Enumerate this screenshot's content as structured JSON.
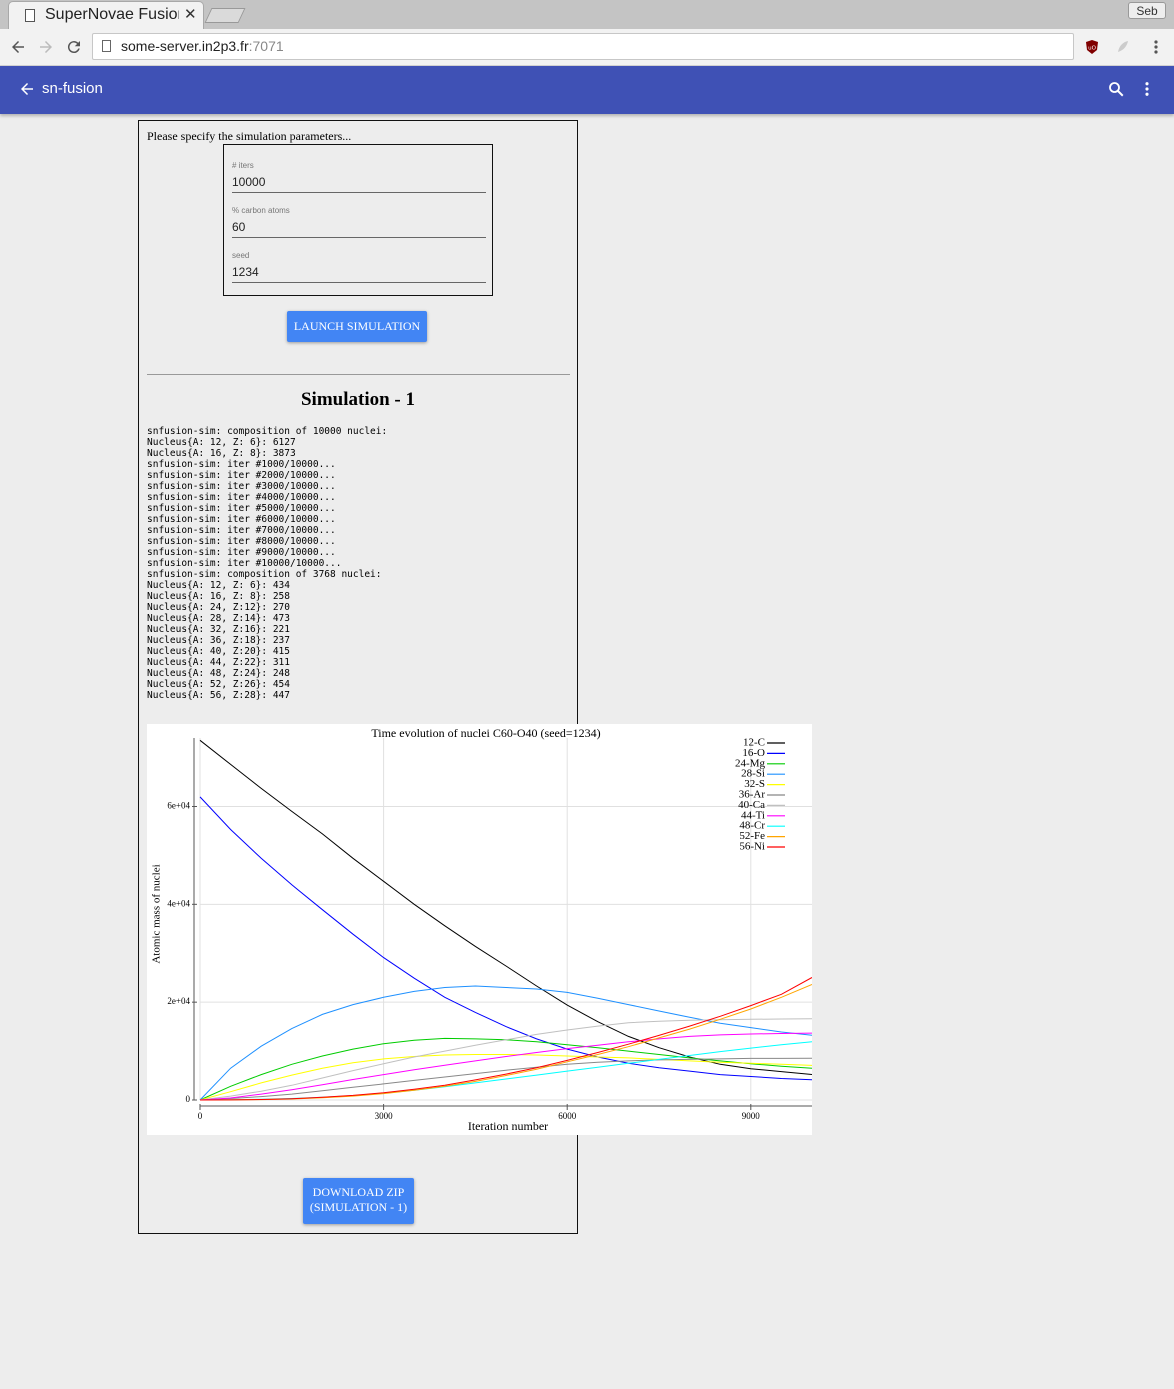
{
  "browser": {
    "tab_title": "SuperNovae Fusion",
    "close_glyph": "✕",
    "profile_name": "Seb",
    "url_host": "some-server.in2p3.fr",
    "url_port": ":7071",
    "icons": [
      "back-icon",
      "forward-icon",
      "reload-icon",
      "page-icon",
      "ublock-icon",
      "extension-icon",
      "menu-icon"
    ]
  },
  "appbar": {
    "title": "sn-fusion",
    "color": "#3f51b5",
    "icons": [
      "arrow-back-icon",
      "search-icon",
      "more-vert-icon"
    ]
  },
  "form": {
    "intro": "Please specify the simulation parameters...",
    "fields": [
      {
        "label": "# iters",
        "value": "10000"
      },
      {
        "label": "% carbon atoms",
        "value": "60"
      },
      {
        "label": "seed",
        "value": "1234"
      }
    ],
    "launch_label": "LAUNCH SIMULATION"
  },
  "simulation": {
    "title": "Simulation - 1",
    "log": "snfusion-sim: composition of 10000 nuclei:\nNucleus{A: 12, Z: 6}: 6127\nNucleus{A: 16, Z: 8}: 3873\nsnfusion-sim: iter #1000/10000...\nsnfusion-sim: iter #2000/10000...\nsnfusion-sim: iter #3000/10000...\nsnfusion-sim: iter #4000/10000...\nsnfusion-sim: iter #5000/10000...\nsnfusion-sim: iter #6000/10000...\nsnfusion-sim: iter #7000/10000...\nsnfusion-sim: iter #8000/10000...\nsnfusion-sim: iter #9000/10000...\nsnfusion-sim: iter #10000/10000...\nsnfusion-sim: composition of 3768 nuclei:\nNucleus{A: 12, Z: 6}: 434\nNucleus{A: 16, Z: 8}: 258\nNucleus{A: 24, Z:12}: 270\nNucleus{A: 28, Z:14}: 473\nNucleus{A: 32, Z:16}: 221\nNucleus{A: 36, Z:18}: 237\nNucleus{A: 40, Z:20}: 415\nNucleus{A: 44, Z:22}: 311\nNucleus{A: 48, Z:24}: 248\nNucleus{A: 52, Z:26}: 454\nNucleus{A: 56, Z:28}: 447",
    "download_label_line1": "DOWNLOAD ZIP",
    "download_label_line2": "(SIMULATION - 1)",
    "button_color": "#4285f4"
  },
  "chart_data": {
    "type": "line",
    "title": "Time evolution of nuclei C60-O40 (seed=1234)",
    "xlabel": "Iteration number",
    "ylabel": "Atomic mass of nuclei",
    "xlim": [
      0,
      10000
    ],
    "ylim": [
      0,
      74000
    ],
    "x_ticks": [
      0,
      3000,
      6000,
      9000
    ],
    "x_tick_labels": [
      "0",
      "3000",
      "6000",
      "9000"
    ],
    "y_ticks": [
      0,
      20000,
      40000,
      60000
    ],
    "y_tick_labels": [
      "0",
      "2e+04",
      "4e+04",
      "6e+04"
    ],
    "grid": true,
    "legend_position": "top-right",
    "x": [
      0,
      500,
      1000,
      1500,
      2000,
      2500,
      3000,
      3500,
      4000,
      4500,
      5000,
      5500,
      6000,
      6500,
      7000,
      7500,
      8000,
      8500,
      9000,
      9500,
      10000
    ],
    "series": [
      {
        "name": "12-C",
        "color": "#000000",
        "values": [
          73524,
          68600,
          63700,
          59000,
          54400,
          49400,
          44700,
          40000,
          35600,
          31400,
          27400,
          23300,
          19400,
          16000,
          13000,
          10700,
          8800,
          7300,
          6400,
          5800,
          5208
        ]
      },
      {
        "name": "16-O",
        "color": "#0000ff",
        "values": [
          61968,
          55300,
          49400,
          44000,
          38900,
          33900,
          29100,
          24900,
          21000,
          17900,
          15000,
          12500,
          10400,
          8800,
          7500,
          6600,
          5900,
          5200,
          4800,
          4400,
          4128
        ]
      },
      {
        "name": "24-Mg",
        "color": "#00cc00",
        "values": [
          0,
          2800,
          5200,
          7300,
          9000,
          10400,
          11500,
          12200,
          12600,
          12500,
          12300,
          11900,
          11300,
          10700,
          10000,
          9300,
          8600,
          8000,
          7400,
          6900,
          6480
        ]
      },
      {
        "name": "28-Si",
        "color": "#1e90ff",
        "values": [
          0,
          6500,
          11000,
          14600,
          17500,
          19500,
          21000,
          22200,
          23000,
          23300,
          23000,
          22700,
          22000,
          20800,
          19500,
          18200,
          16900,
          15700,
          14800,
          13900,
          13244
        ]
      },
      {
        "name": "32-S",
        "color": "#ffff00",
        "values": [
          0,
          1700,
          3500,
          5100,
          6500,
          7600,
          8400,
          8900,
          9200,
          9300,
          9300,
          9200,
          9000,
          8800,
          8600,
          8300,
          8000,
          7700,
          7500,
          7300,
          7072
        ]
      },
      {
        "name": "36-Ar",
        "color": "#888888",
        "values": [
          0,
          300,
          700,
          1200,
          1900,
          2600,
          3300,
          4000,
          4700,
          5400,
          6100,
          6700,
          7300,
          7700,
          8000,
          8200,
          8300,
          8400,
          8500,
          8500,
          8532
        ]
      },
      {
        "name": "40-Ca",
        "color": "#c0c0c0",
        "values": [
          0,
          800,
          1800,
          3000,
          4500,
          6000,
          7400,
          8800,
          10000,
          11200,
          12300,
          13400,
          14300,
          15100,
          15800,
          16100,
          16300,
          16400,
          16500,
          16550,
          16600
        ]
      },
      {
        "name": "44-Ti",
        "color": "#ff00ff",
        "values": [
          0,
          400,
          1200,
          2100,
          3100,
          4200,
          5200,
          6200,
          7100,
          8000,
          8900,
          9700,
          10500,
          11200,
          11900,
          12500,
          13000,
          13300,
          13500,
          13600,
          13684
        ]
      },
      {
        "name": "48-Cr",
        "color": "#00ffff",
        "values": [
          0,
          50,
          150,
          300,
          550,
          900,
          1400,
          2000,
          2700,
          3500,
          4300,
          5100,
          5900,
          6700,
          7500,
          8300,
          9100,
          9900,
          10600,
          11300,
          11904
        ]
      },
      {
        "name": "52-Fe",
        "color": "#ffa500",
        "values": [
          0,
          20,
          80,
          200,
          450,
          800,
          1300,
          2000,
          2800,
          3800,
          5000,
          6300,
          7800,
          9300,
          10900,
          12700,
          14500,
          16500,
          18600,
          21000,
          23608
        ]
      },
      {
        "name": "56-Ni",
        "color": "#ff0000",
        "values": [
          0,
          30,
          100,
          260,
          550,
          950,
          1500,
          2200,
          3000,
          4100,
          5300,
          6600,
          8100,
          9700,
          11400,
          13200,
          15100,
          17100,
          19300,
          21600,
          25032
        ]
      }
    ]
  }
}
